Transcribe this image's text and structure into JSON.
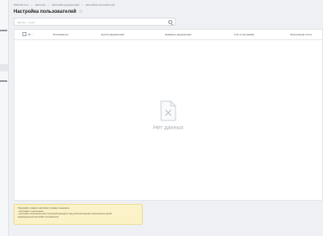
{
  "breadcrumb": [
    "Рабочий стол",
    "Настроки",
    "Настройка уведомлений",
    "Настройка пользователей"
  ],
  "page": {
    "title": "Настройка пользователей"
  },
  "search": {
    "placeholder": "Фильтр + поиск"
  },
  "table": {
    "columns": [
      "ID",
      "Пользователь",
      "Группа уведомлений",
      "Название уведомления",
      "Счёт в программе",
      "Электронная почта"
    ],
    "empty_text": "Нет данных"
  },
  "notice": {
    "lines": [
      "Придумайте правила настройки отправки и выводить:",
      "- настройки по умолчанию;",
      "- настройки пользовательских отношений (выводите над исключительными персональные одной",
      "  индивидуальной настройки пользователя)."
    ]
  },
  "colors": {
    "notice_bg": "#fbf3c7",
    "empty_text": "#a9b1b9"
  }
}
